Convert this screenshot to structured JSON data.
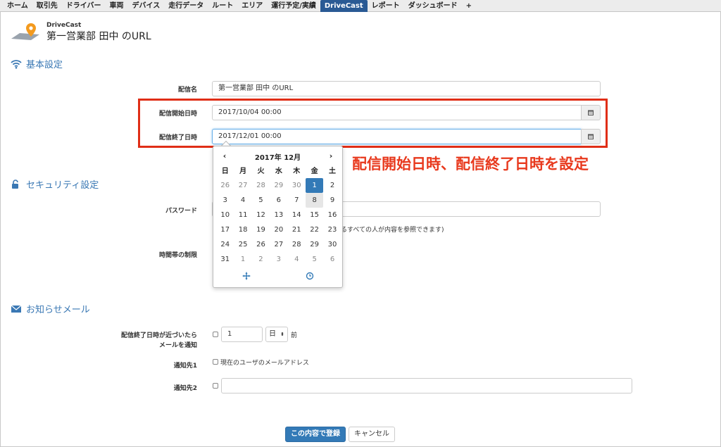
{
  "nav": {
    "items": [
      "ホーム",
      "取引先",
      "ドライバー",
      "車両",
      "デバイス",
      "走行データ",
      "ルート",
      "エリア",
      "運行予定/実績",
      "DriveCast",
      "レポート",
      "ダッシュボード",
      "+"
    ],
    "active_index": 9
  },
  "header": {
    "app_name": "DriveCast",
    "title": "第一営業部 田中 のURL"
  },
  "basic": {
    "heading": "基本設定",
    "name_label": "配信名",
    "name_value": "第一営業部 田中 のURL",
    "start_label": "配信開始日時",
    "start_value": "2017/10/04 00:00",
    "end_label": "配信終了日時",
    "end_value": "2017/12/01 00:00"
  },
  "annotation": "配信開始日時、配信終了日時を設定",
  "security": {
    "heading": "セキュリティ設定",
    "password_label": "パスワード",
    "password_note": "るすべての人が内容を参照できます)",
    "time_limit_label": "時間帯の制限"
  },
  "datepicker": {
    "prev": "‹",
    "next": "›",
    "title": "2017年 12月",
    "dow": [
      "日",
      "月",
      "火",
      "水",
      "木",
      "金",
      "土"
    ],
    "weeks": [
      [
        "26",
        "27",
        "28",
        "29",
        "30",
        "1",
        "2"
      ],
      [
        "3",
        "4",
        "5",
        "6",
        "7",
        "8",
        "9"
      ],
      [
        "10",
        "11",
        "12",
        "13",
        "14",
        "15",
        "16"
      ],
      [
        "17",
        "18",
        "19",
        "20",
        "21",
        "22",
        "23"
      ],
      [
        "24",
        "25",
        "26",
        "27",
        "28",
        "29",
        "30"
      ],
      [
        "31",
        "1",
        "2",
        "3",
        "4",
        "5",
        "6"
      ]
    ],
    "selected": "1",
    "today": "8"
  },
  "mail": {
    "heading": "お知らせメール",
    "notify_label_1": "配信終了日時が近づいたら",
    "notify_label_2": "メールを通知",
    "notify_value": "1",
    "notify_unit": "日",
    "notify_suffix": "前",
    "to1_label": "通知先1",
    "to1_text": "現在のユーザのメールアドレス",
    "to2_label": "通知先2",
    "to2_value": ""
  },
  "actions": {
    "submit": "この内容で登録",
    "cancel": "キャンセル"
  },
  "colors": {
    "accent": "#337ab7",
    "nav_active": "#2a5a94",
    "annotation": "#e8391d",
    "section_heading": "#3a78b4"
  }
}
